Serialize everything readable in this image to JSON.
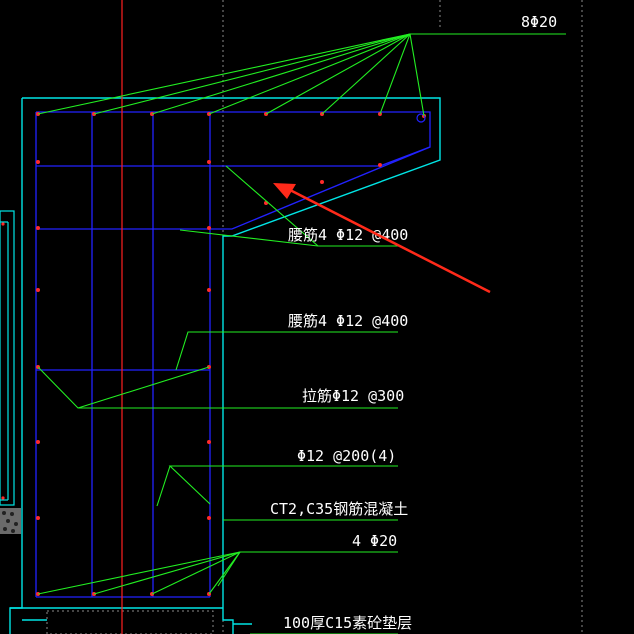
{
  "labels": {
    "top_rebar": "8Φ20",
    "waist_bar_1": "腰筋4 Φ12 @400",
    "waist_bar_2": "腰筋4 Φ12 @400",
    "tie_bar": "拉筋Φ12 @300",
    "stirrup": "Φ12 @200(4)",
    "concrete": "CT2,C35钢筋混凝土",
    "bottom_rebar": "4 Φ20",
    "cushion": "100厚C15素砼垫层"
  },
  "colors": {
    "background": "#000000",
    "outline": "#00e5e5",
    "rebar": "#2222ff",
    "leader": "#22ee22",
    "axis": "#ff2020",
    "text": "#ffffff",
    "annotation_arrow": "#ff2a1a",
    "rebar_dot": "#ff2a2a"
  }
}
